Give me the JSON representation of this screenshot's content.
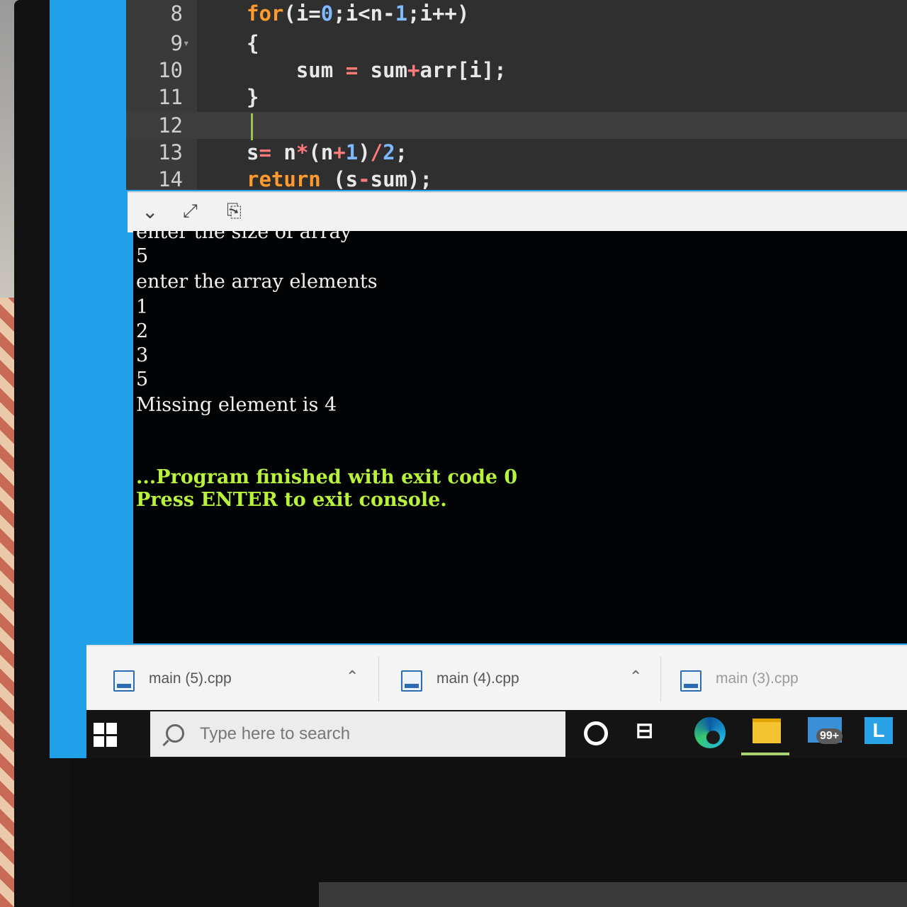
{
  "editor": {
    "lines": [
      {
        "num": "8",
        "code_parts": [
          [
            "kw",
            "for"
          ],
          [
            "plain",
            "(i="
          ],
          [
            "num",
            "0"
          ],
          [
            "plain",
            ";i<n-"
          ],
          [
            "num",
            "1"
          ],
          [
            "plain",
            ";i++)"
          ]
        ]
      },
      {
        "num": "9",
        "fold": "▾",
        "code_parts": [
          [
            "plain",
            "{"
          ]
        ]
      },
      {
        "num": "10",
        "code_parts": [
          [
            "plain",
            "    sum "
          ],
          [
            "op",
            "="
          ],
          [
            "plain",
            " sum"
          ],
          [
            "op",
            "+"
          ],
          [
            "plain",
            "arr[i];"
          ]
        ]
      },
      {
        "num": "11",
        "code_parts": [
          [
            "plain",
            "}"
          ]
        ]
      },
      {
        "num": "12",
        "code_parts": []
      },
      {
        "num": "13",
        "code_parts": [
          [
            "plain",
            "s"
          ],
          [
            "op",
            "="
          ],
          [
            "plain",
            " n"
          ],
          [
            "op",
            "*"
          ],
          [
            "plain",
            "(n"
          ],
          [
            "op",
            "+"
          ],
          [
            "num",
            "1"
          ],
          [
            "plain",
            ")"
          ],
          [
            "op",
            "/"
          ],
          [
            "num",
            "2"
          ],
          [
            "plain",
            ";"
          ]
        ]
      },
      {
        "num": "14",
        "code_parts": [
          [
            "kw",
            "return"
          ],
          [
            "plain",
            " (s"
          ],
          [
            "op",
            "-"
          ],
          [
            "plain",
            "sum);"
          ]
        ]
      }
    ]
  },
  "console_toolbar": {
    "collapse_icon": "chevron-down-icon",
    "expand_icon": "expand-icon",
    "copy_icon": "paste-icon"
  },
  "console": {
    "lines": [
      "enter the size of array",
      "5",
      "enter the array elements",
      "1",
      "2",
      "3",
      "5",
      "Missing element is 4"
    ],
    "finish_line": "...Program finished with exit code 0",
    "press_line": "Press ENTER to exit console."
  },
  "downloads": [
    {
      "name": "main (5).cpp"
    },
    {
      "name": "main (4).cpp"
    },
    {
      "name": "main (3).cpp"
    }
  ],
  "taskbar": {
    "search_placeholder": "Type here to search",
    "mail_badge": "99+",
    "app_letter": "L"
  }
}
